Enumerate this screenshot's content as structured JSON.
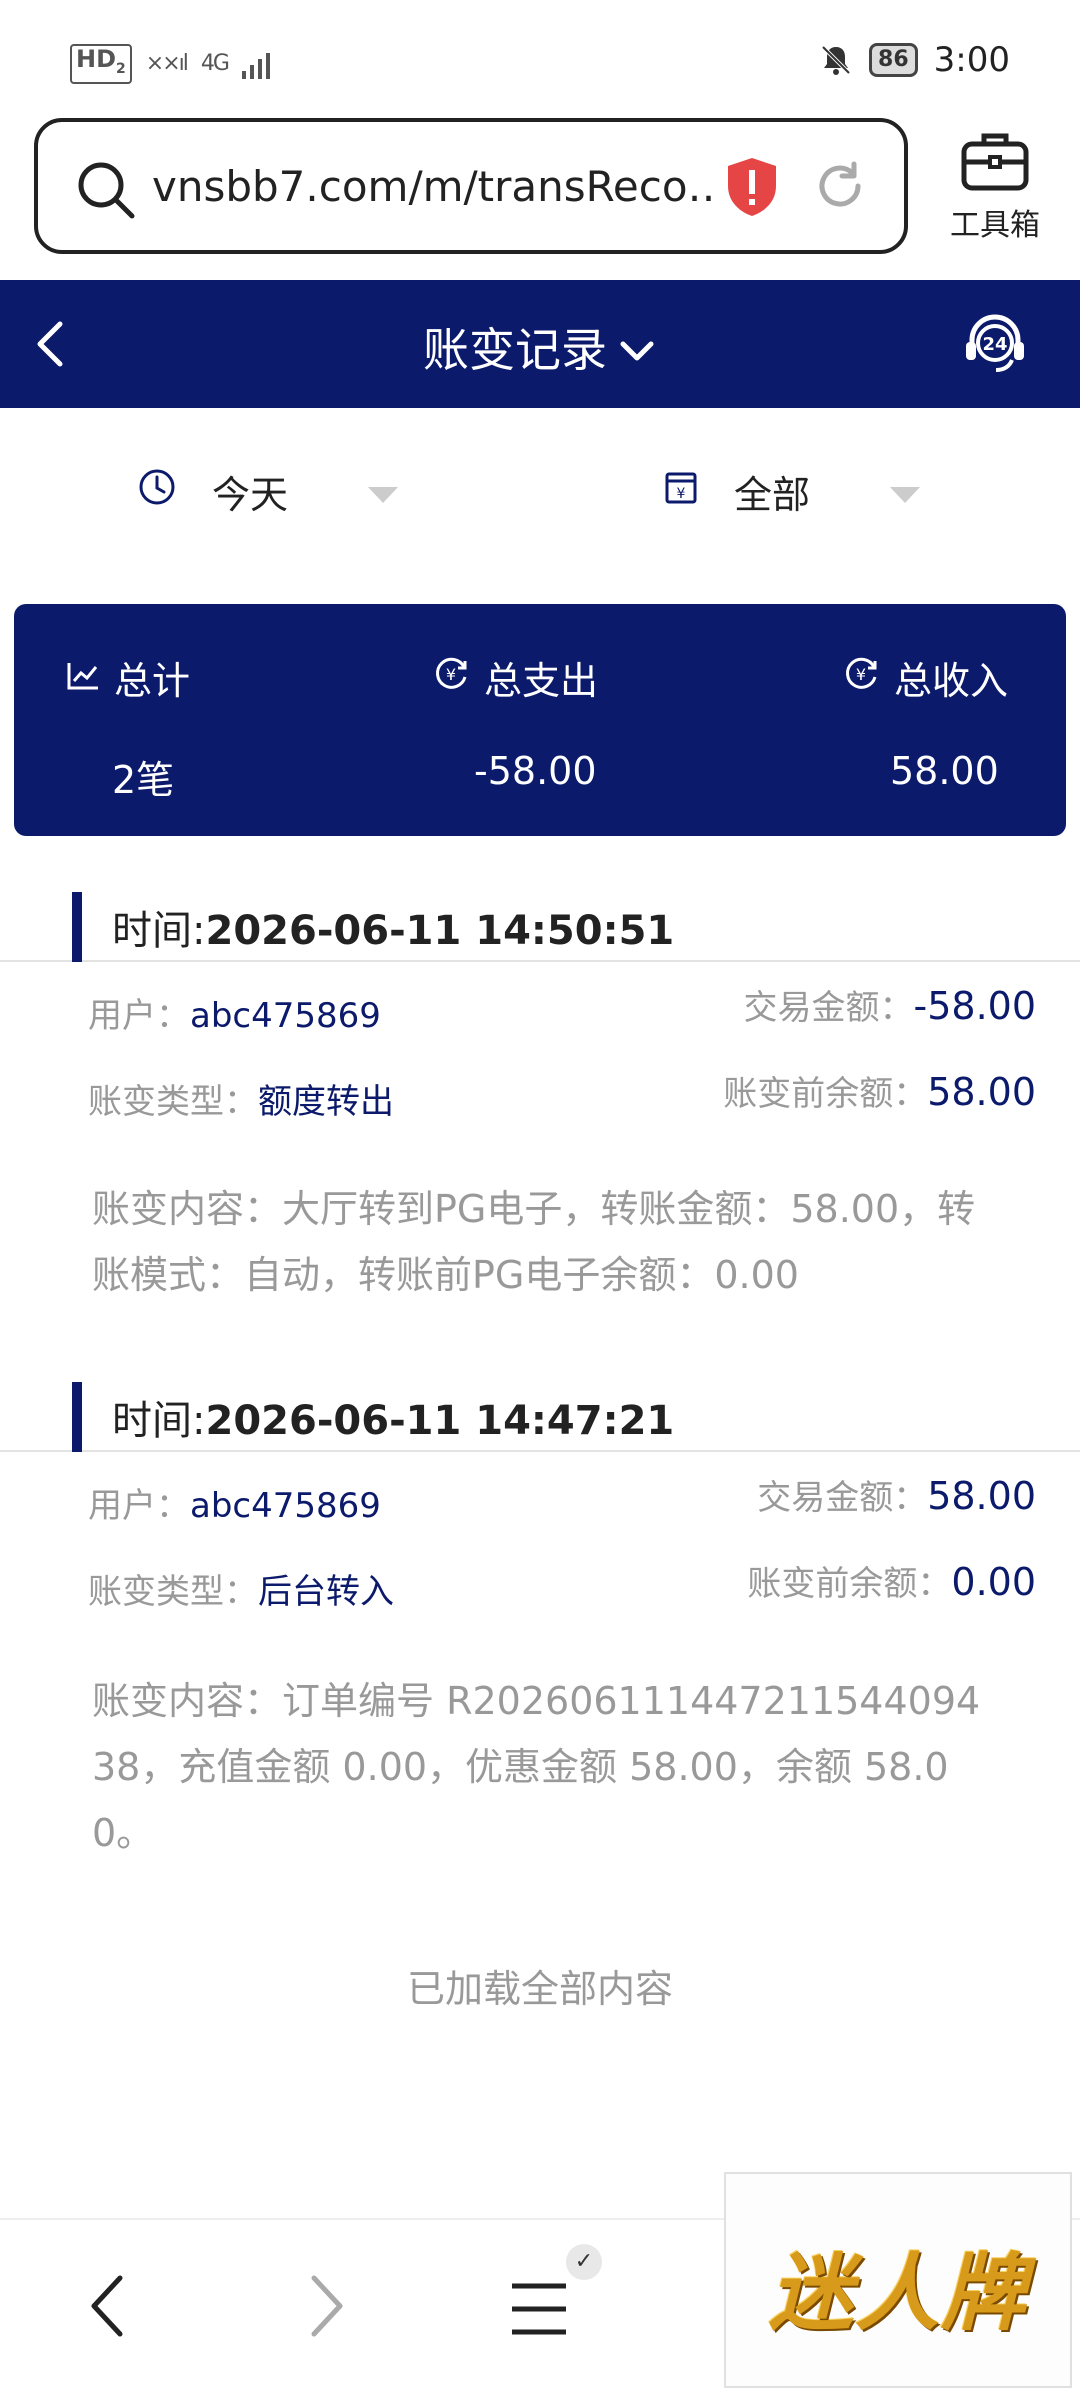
{
  "status_bar": {
    "hd_label": "HD",
    "hd_sub": "2",
    "signal_left": "××ıl",
    "network": "4G",
    "battery": "86",
    "time": "3:00"
  },
  "browser": {
    "url": "vnsbb7.com/m/transReco…",
    "toolbox_label": "工具箱"
  },
  "header": {
    "title": "账变记录"
  },
  "filters": {
    "date": "今天",
    "category": "全部"
  },
  "summary": {
    "total_label": "总计",
    "total_value": "2笔",
    "expense_label": "总支出",
    "expense_value": "-58.00",
    "income_label": "总收入",
    "income_value": "58.00"
  },
  "records": [
    {
      "time_prefix": "时间:",
      "time": "2026-06-11 14:50:51",
      "user_label": "用户：",
      "user": "abc475869",
      "amount_label": "交易金额：",
      "amount": "-58.00",
      "type_label": "账变类型：",
      "type": "额度转出",
      "balance_label": "账变前余额：",
      "balance": "58.00",
      "content": "账变内容：大厅转到PG电子，转账金额：58.00，转账模式：自动，转账前PG电子余额：0.00"
    },
    {
      "time_prefix": "时间:",
      "time": "2026-06-11 14:47:21",
      "user_label": "用户：",
      "user": "abc475869",
      "amount_label": "交易金额：",
      "amount": "58.00",
      "type_label": "账变类型：",
      "type": "后台转入",
      "balance_label": "账变前余额：",
      "balance": "0.00",
      "content": "账变内容：订单编号 R20260611144721154409438，充值金额 0.00，优惠金额 58.00，余额 58.00。"
    }
  ],
  "footer_text": "已加载全部内容",
  "watermark": "迷人牌",
  "colors": {
    "brand_navy": "#0c1a6b",
    "muted_text": "#999999",
    "shield_red": "#e64545"
  },
  "icons": {
    "search": "search-icon",
    "shield": "shield-alert-icon",
    "reload": "reload-icon",
    "toolbox": "toolbox-icon",
    "back": "chevron-left-icon",
    "dropdown": "chevron-down-icon",
    "support": "support-24-icon",
    "clock": "clock-icon",
    "calendar": "calendar-icon",
    "chart": "chart-icon",
    "yen": "yen-circle-icon",
    "menu": "menu-icon"
  }
}
